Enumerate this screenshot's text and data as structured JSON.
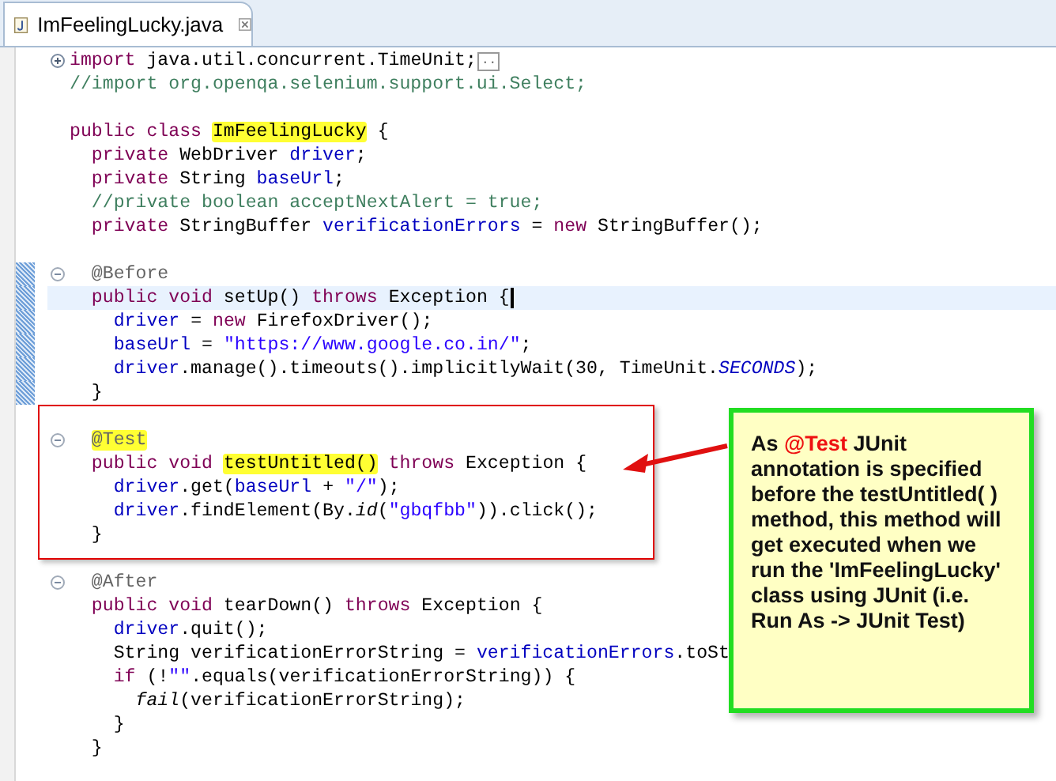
{
  "tab": {
    "title": "ImFeelingLucky.java",
    "selected": true
  },
  "lines": [
    {
      "folded": true,
      "tokens": [
        {
          "text": "import",
          "kind": "keyword"
        },
        {
          "text": " java.util.concurrent.TimeUnit;",
          "kind": "plain"
        },
        {
          "text": "..",
          "kind": "collapsed"
        }
      ]
    },
    {
      "tokens": [
        {
          "text": "//import org.openqa.selenium.support.ui.Select;",
          "kind": "comment"
        }
      ]
    },
    {
      "space_before": true,
      "tokens": [
        {
          "text": "public class ",
          "kind": "keyword"
        },
        {
          "text": "ImFeelingLucky",
          "kind": "plain",
          "highlighted": true
        },
        {
          "text": " {",
          "kind": "plain"
        }
      ]
    },
    {
      "tokens": [
        {
          "text": "  private",
          "kind": "keyword"
        },
        {
          "text": " WebDriver ",
          "kind": "plain"
        },
        {
          "text": "driver",
          "kind": "field"
        },
        {
          "text": ";",
          "kind": "plain"
        }
      ]
    },
    {
      "tokens": [
        {
          "text": "  private",
          "kind": "keyword"
        },
        {
          "text": " String ",
          "kind": "plain"
        },
        {
          "text": "baseUrl",
          "kind": "field"
        },
        {
          "text": ";",
          "kind": "plain"
        }
      ]
    },
    {
      "tokens": [
        {
          "text": "  //private boolean acceptNextAlert = true;",
          "kind": "comment"
        }
      ]
    },
    {
      "tokens": [
        {
          "text": "  private",
          "kind": "keyword"
        },
        {
          "text": " StringBuffer ",
          "kind": "plain"
        },
        {
          "text": "verificationErrors",
          "kind": "field"
        },
        {
          "text": " = ",
          "kind": "plain"
        },
        {
          "text": "new",
          "kind": "keyword"
        },
        {
          "text": " StringBuffer();",
          "kind": "plain"
        }
      ]
    },
    {
      "space_before": true,
      "folded": false,
      "marked": true,
      "tokens": [
        {
          "text": "  @Before",
          "kind": "annotation"
        }
      ]
    },
    {
      "marked": true,
      "current": true,
      "tokens": [
        {
          "text": "  public void",
          "kind": "keyword"
        },
        {
          "text": " setUp() ",
          "kind": "plain"
        },
        {
          "text": "throws",
          "kind": "keyword"
        },
        {
          "text": " Exception {",
          "kind": "plain"
        }
      ]
    },
    {
      "marked": true,
      "tokens": [
        {
          "text": "    driver",
          "kind": "field"
        },
        {
          "text": " = ",
          "kind": "plain"
        },
        {
          "text": "new",
          "kind": "keyword"
        },
        {
          "text": " FirefoxDriver();",
          "kind": "plain"
        }
      ]
    },
    {
      "marked": true,
      "tokens": [
        {
          "text": "    baseUrl",
          "kind": "field"
        },
        {
          "text": " = ",
          "kind": "plain"
        },
        {
          "text": "\"https://www.google.co.in/\"",
          "kind": "string"
        },
        {
          "text": ";",
          "kind": "plain"
        }
      ]
    },
    {
      "marked": true,
      "tokens": [
        {
          "text": "    driver",
          "kind": "field"
        },
        {
          "text": ".manage().timeouts().implicitlyWait(30, TimeUnit.",
          "kind": "plain"
        },
        {
          "text": "SECONDS",
          "kind": "static"
        },
        {
          "text": ");",
          "kind": "plain"
        }
      ]
    },
    {
      "marked": true,
      "tokens": [
        {
          "text": "  }",
          "kind": "plain"
        }
      ]
    },
    {
      "space_before": true,
      "folded": false,
      "tokens": [
        {
          "text": "  @Test",
          "kind": "annotation",
          "highlighted": true
        }
      ]
    },
    {
      "tokens": [
        {
          "text": "  public void ",
          "kind": "keyword"
        },
        {
          "text": "testUntitled()",
          "kind": "plain",
          "highlighted": true
        },
        {
          "text": " throws",
          "kind": "keyword"
        },
        {
          "text": " Exception {",
          "kind": "plain"
        }
      ]
    },
    {
      "tokens": [
        {
          "text": "    driver",
          "kind": "field"
        },
        {
          "text": ".get(",
          "kind": "plain"
        },
        {
          "text": "baseUrl",
          "kind": "field"
        },
        {
          "text": " + ",
          "kind": "plain"
        },
        {
          "text": "\"/\"",
          "kind": "string"
        },
        {
          "text": ");",
          "kind": "plain"
        }
      ]
    },
    {
      "tokens": [
        {
          "text": "    driver",
          "kind": "field"
        },
        {
          "text": ".findElement(By.",
          "kind": "plain"
        },
        {
          "text": "id",
          "kind": "static-method"
        },
        {
          "text": "(",
          "kind": "plain"
        },
        {
          "text": "\"gbqfbb\"",
          "kind": "string"
        },
        {
          "text": ")).click();",
          "kind": "plain"
        }
      ]
    },
    {
      "tokens": [
        {
          "text": "  }",
          "kind": "plain"
        }
      ]
    },
    {
      "space_before": true,
      "folded": false,
      "tokens": [
        {
          "text": "  @After",
          "kind": "annotation"
        }
      ]
    },
    {
      "tokens": [
        {
          "text": "  public void",
          "kind": "keyword"
        },
        {
          "text": " tearDown() ",
          "kind": "plain"
        },
        {
          "text": "throws",
          "kind": "keyword"
        },
        {
          "text": " Exception {",
          "kind": "plain"
        }
      ]
    },
    {
      "tokens": [
        {
          "text": "    driver",
          "kind": "field"
        },
        {
          "text": ".quit();",
          "kind": "plain"
        }
      ]
    },
    {
      "tokens": [
        {
          "text": "    String verificationErrorString = ",
          "kind": "plain"
        },
        {
          "text": "verificationErrors",
          "kind": "field"
        },
        {
          "text": ".toSt",
          "kind": "plain"
        }
      ]
    },
    {
      "tokens": [
        {
          "text": "    if",
          "kind": "keyword"
        },
        {
          "text": " (!",
          "kind": "plain"
        },
        {
          "text": "\"\"",
          "kind": "string"
        },
        {
          "text": ".equals(verificationErrorString)) {",
          "kind": "plain"
        }
      ]
    },
    {
      "tokens": [
        {
          "text": "      fail",
          "kind": "static-method"
        },
        {
          "text": "(verificationErrorString);",
          "kind": "plain"
        }
      ]
    },
    {
      "tokens": [
        {
          "text": "    }",
          "kind": "plain"
        }
      ]
    },
    {
      "tokens": [
        {
          "text": "  }",
          "kind": "plain"
        }
      ]
    }
  ],
  "callout": {
    "parts": [
      {
        "text": "As ",
        "kind": "plain"
      },
      {
        "text": "@Test",
        "kind": "emphasis"
      },
      {
        "text": " JUnit annotation is specified before the testUntitled( ) method, this method will get executed when we run the 'ImFeelingLucky' class using JUnit (i.e. Run As -> JUnit Test)",
        "kind": "plain"
      }
    ]
  }
}
